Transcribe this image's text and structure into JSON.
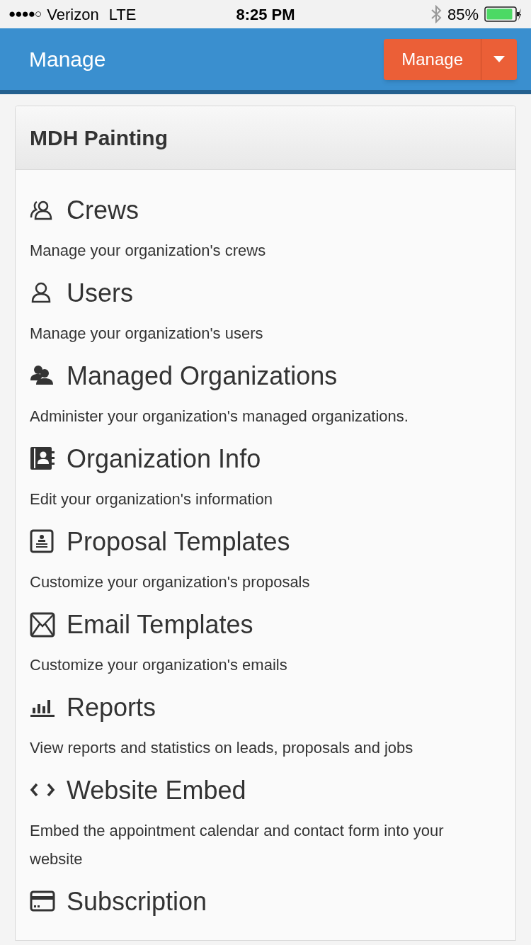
{
  "status_bar": {
    "signal": "●●●●○",
    "carrier": "Verizon",
    "network": "LTE",
    "time": "8:25 PM",
    "battery": "85%"
  },
  "header": {
    "title": "Manage",
    "button": "Manage"
  },
  "card": {
    "title": "MDH Painting",
    "items": [
      {
        "kind": "crews",
        "title": "Crews",
        "description": "Manage your organization's crews"
      },
      {
        "kind": "user",
        "title": "Users",
        "description": "Manage your organization's users"
      },
      {
        "kind": "managed",
        "title": "Managed Organizations",
        "description": "Administer your organization's managed organizations."
      },
      {
        "kind": "contact",
        "title": "Organization Info",
        "description": "Edit your organization's information"
      },
      {
        "kind": "proposal",
        "title": "Proposal Templates",
        "description": "Customize your organization's proposals"
      },
      {
        "kind": "email",
        "title": "Email Templates",
        "description": "Customize your organization's emails"
      },
      {
        "kind": "chart",
        "title": "Reports",
        "description": "View reports and statistics on leads, proposals and jobs"
      },
      {
        "kind": "code",
        "title": "Website Embed",
        "description": "Embed the appointment calendar and contact form into your website"
      },
      {
        "kind": "card",
        "title": "Subscription"
      }
    ]
  }
}
